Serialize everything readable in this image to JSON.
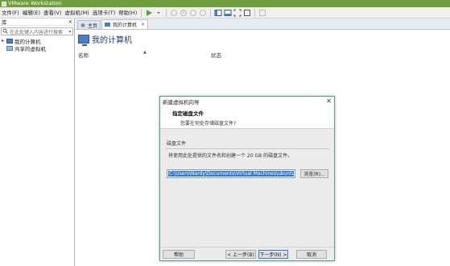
{
  "window": {
    "title": "VMware Workstation"
  },
  "menu": [
    "文件(F)",
    "编辑(E)",
    "查看(V)",
    "虚拟机(M)",
    "选项卡(T)",
    "帮助(H)"
  ],
  "toolbar": {
    "icons": [
      "play-icon",
      "dropdown-arrow-icon",
      "snapshot-icon",
      "revert-icon",
      "snapshot-manager-icon",
      "clone-icon",
      "library-view-icon",
      "console-view-icon",
      "fullscreen-icon",
      "unity-icon",
      "preferences-icon"
    ]
  },
  "library": {
    "title": "库",
    "close": "×",
    "search_placeholder": "在此处键入内容进行搜索",
    "items": [
      {
        "label": "我的计算机",
        "expanded": true
      },
      {
        "label": "共享的虚拟机"
      }
    ]
  },
  "tabs": [
    {
      "label": "主页",
      "active": false
    },
    {
      "label": "我的计算机",
      "active": true,
      "close": "×"
    }
  ],
  "main": {
    "title": "我的计算机",
    "columns": {
      "name": "名称",
      "status": "状态"
    }
  },
  "dialog": {
    "title": "新建虚拟机向导",
    "close": "✕",
    "heading": "指定磁盘文件",
    "subheading": "您要在何处存储磁盘文件?",
    "group_label": "磁盘文件",
    "description": "将使用此处提供的文件名和创建一个 20 GB 的磁盘文件。",
    "path_value": "C:\\Users\\Nardy\\Documents\\Virtual Machines\\ubuntu.vmware",
    "browse_label": "浏览(R)...",
    "help_label": "帮助",
    "back_label": "< 上一步(B)",
    "next_label": "下一步(N) >",
    "cancel_label": "取消"
  },
  "colors": {
    "titlebar": "#6f9e3e",
    "selection": "#3a79d3",
    "dialog_border": "#5aa085"
  }
}
